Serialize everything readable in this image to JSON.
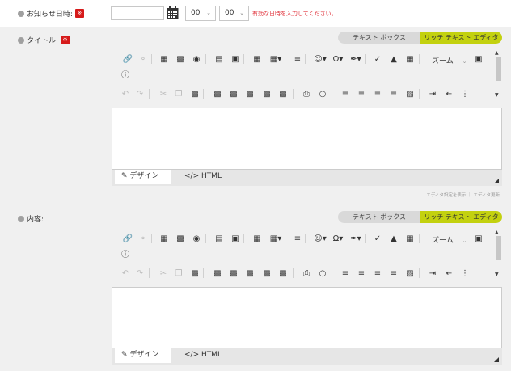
{
  "date_row": {
    "label": "お知らせ日時:",
    "required": "※",
    "hour": "00",
    "minute": "00",
    "error": "有効な日時を入力してください。"
  },
  "title_row": {
    "label": "タイトル:",
    "required": "※"
  },
  "content_row": {
    "label": "内容:"
  },
  "editor": {
    "mode_text": "テキスト ボックス",
    "mode_rich": "リッチ テキスト エディタ",
    "zoom_label": "ズーム",
    "tab_design": "デザイン",
    "tab_html": "HTML",
    "note_settings": "エディタ設定を表示",
    "note_update": "エディタ更新"
  }
}
